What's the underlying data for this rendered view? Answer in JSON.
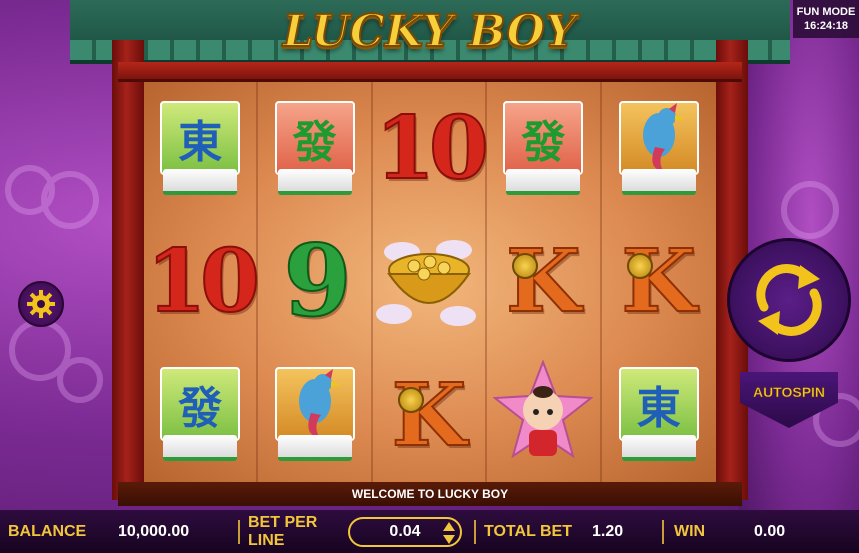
{
  "header": {
    "title": "LUCKY BOY",
    "fun_mode": "FUN MODE",
    "clock": "16:24:18"
  },
  "reels": [
    [
      {
        "type": "mahjong",
        "glyph": "東",
        "tile": "green"
      },
      {
        "type": "number",
        "glyph": "10",
        "color": "red"
      },
      {
        "type": "mahjong",
        "glyph": "發",
        "tile": "green"
      }
    ],
    [
      {
        "type": "mahjong",
        "glyph": "發",
        "tile": "red"
      },
      {
        "type": "number",
        "glyph": "9",
        "color": "green"
      },
      {
        "type": "mahjong-bird",
        "glyph": "",
        "tile": "bird"
      }
    ],
    [
      {
        "type": "number",
        "glyph": "10",
        "color": "red"
      },
      {
        "type": "gold-bowl",
        "glyph": ""
      },
      {
        "type": "king",
        "glyph": "K"
      }
    ],
    [
      {
        "type": "mahjong",
        "glyph": "發",
        "tile": "red"
      },
      {
        "type": "king",
        "glyph": "K"
      },
      {
        "type": "boy-star",
        "glyph": ""
      }
    ],
    [
      {
        "type": "mahjong-bird",
        "glyph": "",
        "tile": "bird"
      },
      {
        "type": "king",
        "glyph": "K"
      },
      {
        "type": "mahjong",
        "glyph": "東",
        "tile": "green"
      }
    ]
  ],
  "controls": {
    "settings_icon": "gear-icon",
    "spin_icon": "spin-arrows-icon",
    "autospin_label": "AUTOSPIN"
  },
  "message": "WELCOME TO LUCKY BOY",
  "bottom": {
    "balance_label": "BALANCE",
    "balance_value": "10,000.00",
    "bet_per_line_label": "BET PER LINE",
    "bet_per_line_value": "0.04",
    "total_bet_label": "TOTAL BET",
    "total_bet_value": "1.20",
    "win_label": "WIN",
    "win_value": "0.00"
  },
  "colors": {
    "accent_gold": "#f2c63a",
    "background_purple": "#7a2a92",
    "reel_bg": "#dc8950"
  }
}
